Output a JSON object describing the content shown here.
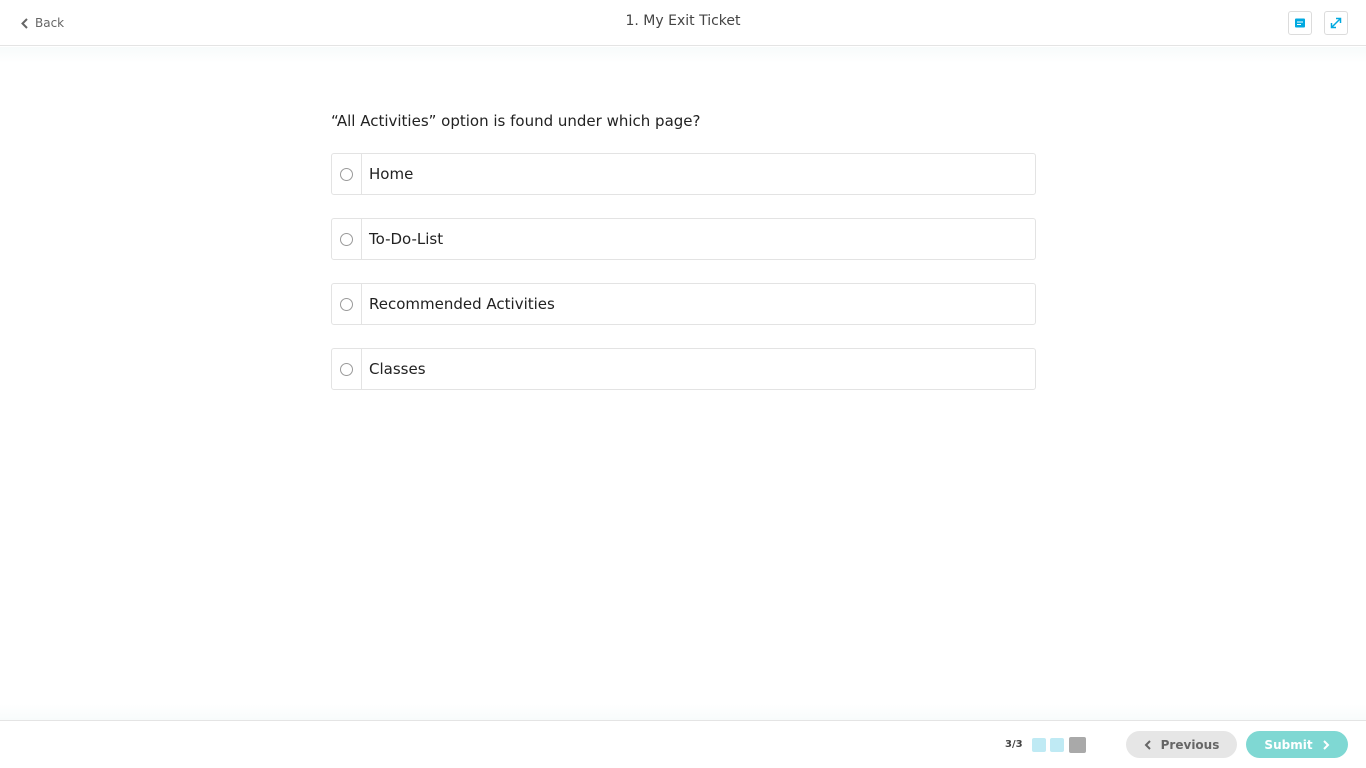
{
  "header": {
    "back_label": "Back",
    "title": "1. My Exit Ticket",
    "notes_icon": "notes-icon",
    "expand_icon": "expand-icon"
  },
  "question": {
    "text": "“All Activities” option is found under which page?",
    "options": [
      {
        "label": "Home",
        "selected": false
      },
      {
        "label": "To-Do-List",
        "selected": false
      },
      {
        "label": "Recommended Activities",
        "selected": false
      },
      {
        "label": "Classes",
        "selected": false
      }
    ]
  },
  "footer": {
    "progress": "3/3",
    "progress_current": 3,
    "progress_total": 3,
    "previous_label": "Previous",
    "submit_label": "Submit"
  },
  "colors": {
    "accent": "#00a9e0",
    "submit_bg": "#7fd8d3",
    "visited_dot": "#bfeaf4",
    "current_dot": "#a9a9a9"
  }
}
